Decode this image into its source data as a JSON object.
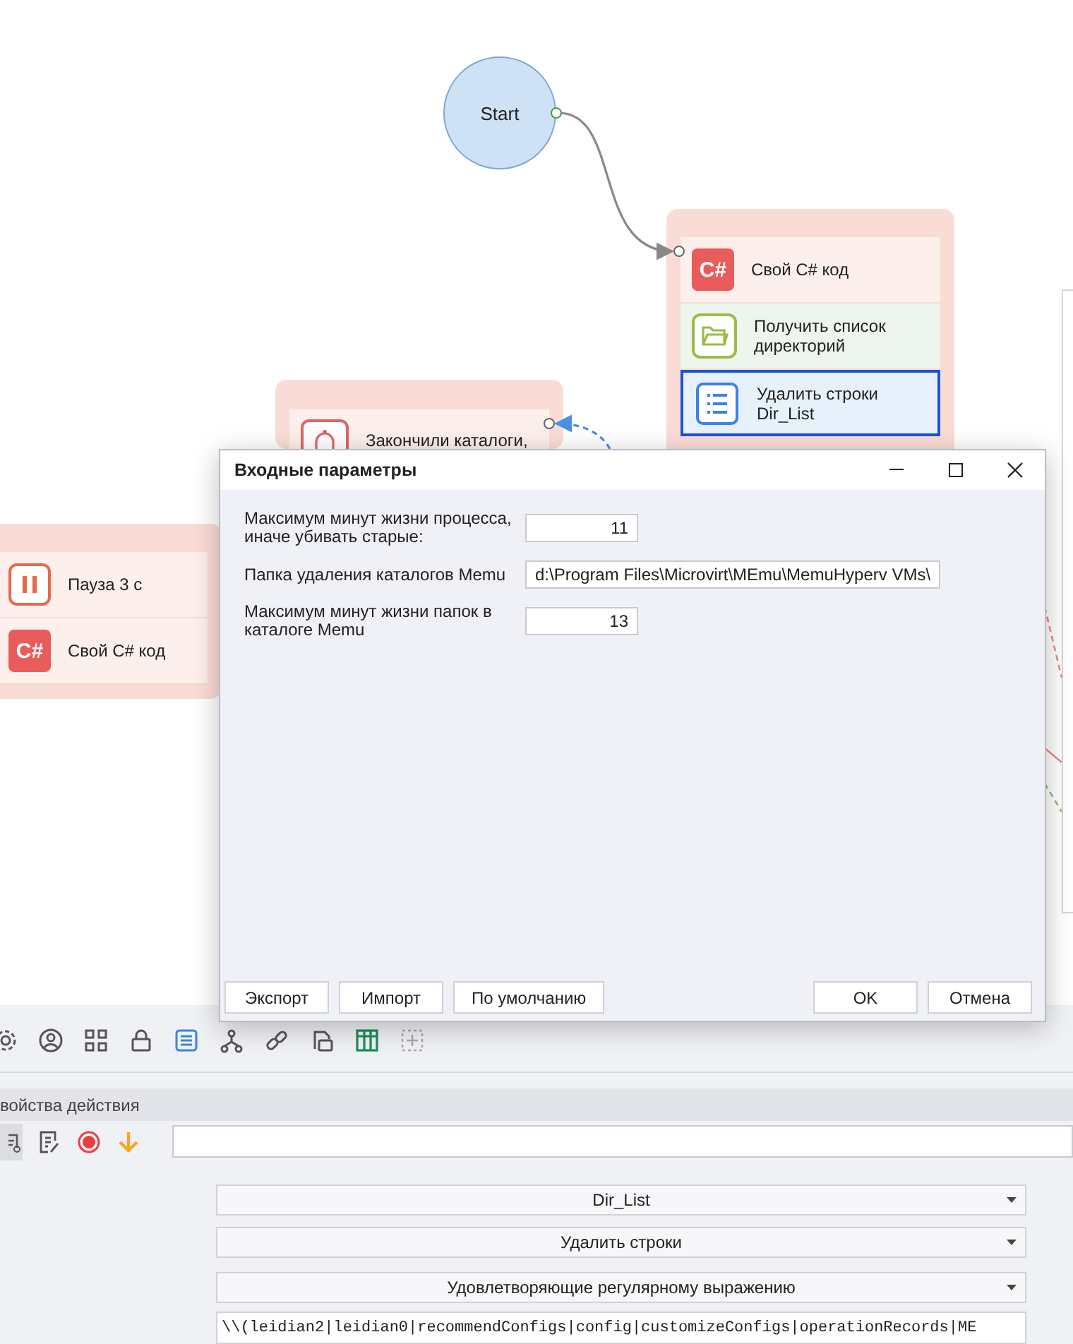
{
  "canvas": {
    "start_node": {
      "label": "Start"
    },
    "groups": [
      {
        "items": [
          {
            "kind": "csharp",
            "icon_text": "C#",
            "label_lines": [
              "Свой C# код"
            ],
            "selected": false
          },
          {
            "kind": "folder",
            "label_lines": [
              "Получить список",
              "директорий"
            ],
            "selected": false
          },
          {
            "kind": "list",
            "label_lines": [
              "Удалить строки",
              "Dir_List"
            ],
            "selected": true
          }
        ]
      },
      {
        "items": [
          {
            "kind": "bell",
            "label_lines": [
              "Закончили каталоги,"
            ],
            "selected": false
          }
        ]
      },
      {
        "items": [
          {
            "kind": "pause",
            "label_lines": [
              "Пауза 3 с"
            ],
            "selected": false
          },
          {
            "kind": "csharp",
            "icon_text": "C#",
            "label_lines": [
              "Свой C# код"
            ],
            "selected": false
          }
        ]
      }
    ]
  },
  "dialog": {
    "title": "Входные параметры",
    "fields": [
      {
        "label": "Максимум минут жизни процесса, иначе убивать старые:",
        "value": "11",
        "kind": "number"
      },
      {
        "label": "Папка удаления каталогов Memu",
        "value": "d:\\Program Files\\Microvirt\\MEmu\\MemuHyperv VMs\\",
        "kind": "path"
      },
      {
        "label": "Максимум минут жизни папок в каталоге Memu",
        "value": "13",
        "kind": "number"
      }
    ],
    "left_buttons": [
      "Экспорт",
      "Импорт",
      "По умолчанию"
    ],
    "right_buttons": [
      "OK",
      "Отмена"
    ]
  },
  "properties": {
    "title": "войства действия",
    "dropdowns": [
      "Dir_List",
      "Удалить строки",
      "Удовлетворяющие регулярному выражению"
    ],
    "regex_field": {
      "value": "\\\\(leidian2|leidian0|recommendConfigs|config|customizeConfigs|operationRecords|ME"
    }
  }
}
